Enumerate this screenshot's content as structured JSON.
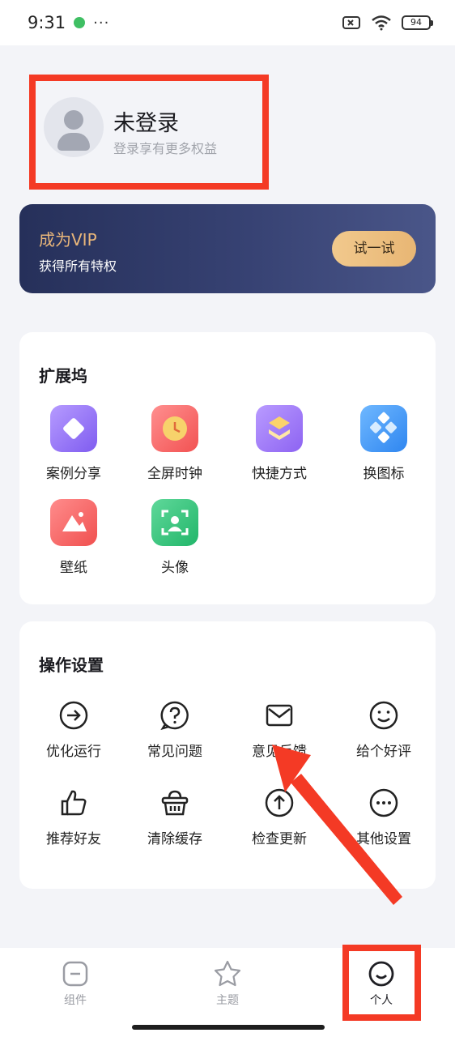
{
  "status_bar": {
    "time": "9:31",
    "more": "···",
    "battery": "94"
  },
  "profile": {
    "name": "未登录",
    "subtitle": "登录享有更多权益"
  },
  "vip": {
    "title": "成为VIP",
    "subtitle": "获得所有特权",
    "button": "试一试"
  },
  "extensions": {
    "title": "扩展坞",
    "items": [
      {
        "label": "案例分享",
        "icon": "case-share-icon"
      },
      {
        "label": "全屏时钟",
        "icon": "clock-icon"
      },
      {
        "label": "快捷方式",
        "icon": "shortcut-icon"
      },
      {
        "label": "换图标",
        "icon": "change-icon-icon"
      },
      {
        "label": "壁纸",
        "icon": "wallpaper-icon"
      },
      {
        "label": "头像",
        "icon": "avatar-icon"
      }
    ]
  },
  "operations": {
    "title": "操作设置",
    "items": [
      {
        "label": "优化运行",
        "icon": "arrow-right-circle-icon"
      },
      {
        "label": "常见问题",
        "icon": "question-icon"
      },
      {
        "label": "意见反馈",
        "icon": "mail-icon"
      },
      {
        "label": "给个好评",
        "icon": "smile-icon"
      },
      {
        "label": "推荐好友",
        "icon": "thumbs-up-icon"
      },
      {
        "label": "清除缓存",
        "icon": "basket-icon"
      },
      {
        "label": "检查更新",
        "icon": "arrow-up-circle-icon"
      },
      {
        "label": "其他设置",
        "icon": "more-circle-icon"
      }
    ]
  },
  "bottom_nav": {
    "items": [
      {
        "label": "组件",
        "icon": "widget-icon",
        "active": false
      },
      {
        "label": "主题",
        "icon": "star-icon",
        "active": false
      },
      {
        "label": "个人",
        "icon": "smile-icon",
        "active": true
      }
    ]
  },
  "colors": {
    "accent_red": "#f43a25",
    "vip_gold": "#e9b67a",
    "vip_bg": "#2c3561"
  }
}
